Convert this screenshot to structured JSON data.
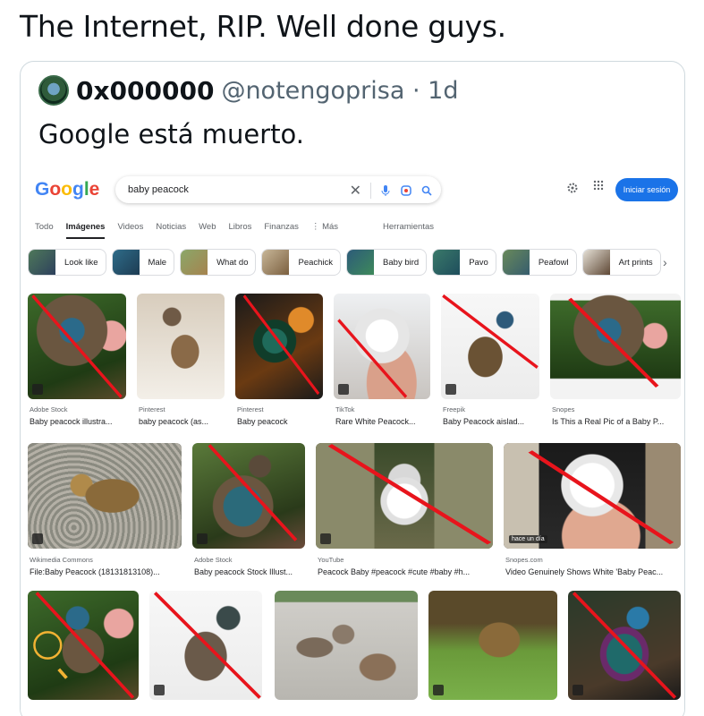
{
  "post": {
    "text": "The Internet, RIP. Well done guys."
  },
  "quote": {
    "name": "0x000000",
    "handle": "@notengoprisa · 1d",
    "text": "Google está muerto."
  },
  "google": {
    "logo": [
      "G",
      "o",
      "o",
      "g",
      "l",
      "e"
    ],
    "query": "baby peacock",
    "login": "Iniciar sesión",
    "tabs": [
      "Todo",
      "Imágenes",
      "Videos",
      "Noticias",
      "Web",
      "Libros",
      "Finanzas",
      "⋮ Más"
    ],
    "active_tab": "Imágenes",
    "tools": "Herramientas",
    "chips": [
      "Look like",
      "Male",
      "What do",
      "Peachick",
      "Baby bird",
      "Pavo",
      "Peafowl",
      "Art prints"
    ],
    "results": [
      {
        "source": "Adobe Stock",
        "caption": "Baby peacock illustra..."
      },
      {
        "source": "Pinterest",
        "caption": "baby peacock (as..."
      },
      {
        "source": "Pinterest",
        "caption": "Baby peacock"
      },
      {
        "source": "TikTok",
        "caption": "Rare White Peacock..."
      },
      {
        "source": "Freepik",
        "caption": "Baby Peacock aislad..."
      },
      {
        "source": "Snopes",
        "caption": "Is This a Real Pic of a Baby P..."
      },
      {
        "source": "Wikimedia Commons",
        "caption": "File:Baby Peacock (18131813108)..."
      },
      {
        "source": "Adobe Stock",
        "caption": "Baby peacock Stock Illust..."
      },
      {
        "source": "YouTube",
        "caption": "Peacock Baby #peacock #cute #baby #h..."
      },
      {
        "source": "Snopes.com",
        "caption": "Video Genuinely Shows White 'Baby Peac..."
      }
    ],
    "hace_label": "hace un día"
  }
}
